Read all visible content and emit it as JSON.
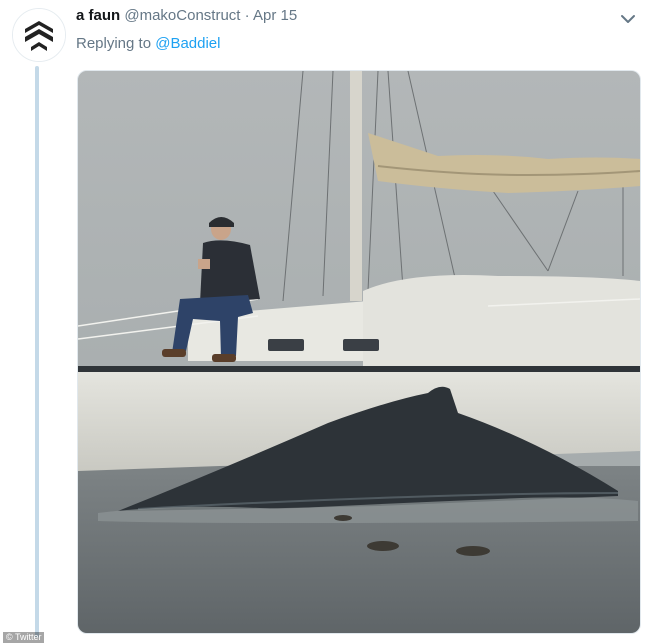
{
  "tweet": {
    "display_name": "a faun",
    "handle": "@makoConstruct",
    "separator": "·",
    "date": "Apr 15",
    "reply_prefix": "Replying to",
    "reply_to": "@Baddiel",
    "avatar_icon": "avatar-logo-icon",
    "menu_icon": "chevron-down-icon"
  },
  "media": {
    "description_icon": "photo",
    "palette": {
      "sky": "#b4b9ba",
      "water": "#6f7577",
      "hull": "#dcdcd6",
      "whale": "#2c3238",
      "sail": "#cdbf9d"
    }
  },
  "watermark": "© Twitter"
}
